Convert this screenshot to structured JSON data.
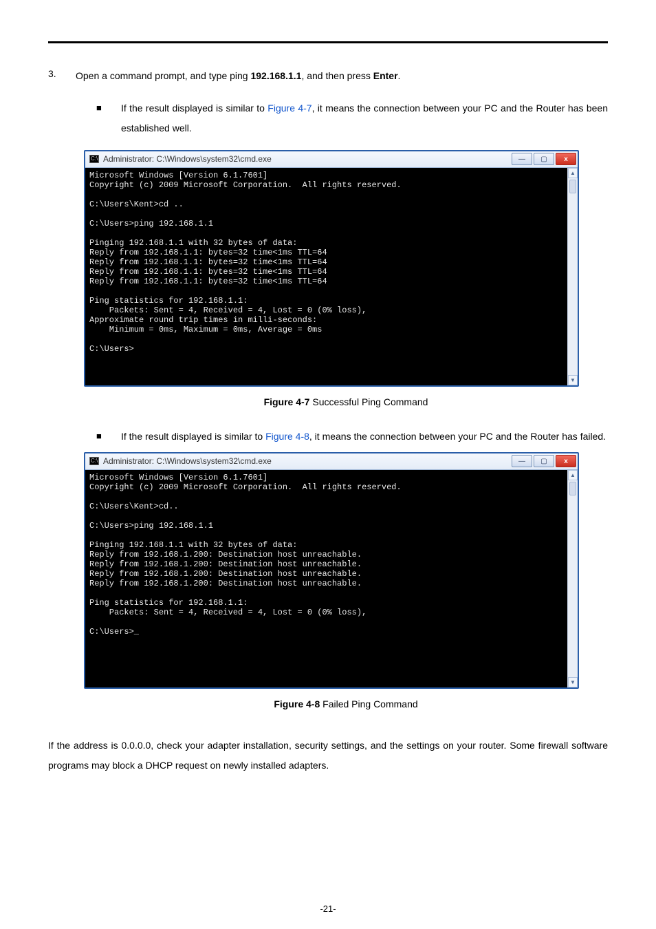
{
  "step": {
    "number": "3.",
    "pre": "Open a command prompt, and type ping ",
    "cmd": "192.168.1.1",
    "mid": ", and then press ",
    "enter": "Enter",
    "end": "."
  },
  "bullet_glyph": "■",
  "sub1": {
    "pre": "If the result displayed is similar to ",
    "link": "Figure 4-7",
    "post": ", it means the connection between your PC and the Router has been established well."
  },
  "sub2": {
    "pre": "If the result displayed is similar to ",
    "link": "Figure 4-8",
    "post": ", it means the connection between your PC and the Router has failed."
  },
  "cmd_title": "Administrator: C:\\Windows\\system32\\cmd.exe",
  "term1": "Microsoft Windows [Version 6.1.7601]\nCopyright (c) 2009 Microsoft Corporation.  All rights reserved.\n\nC:\\Users\\Kent>cd ..\n\nC:\\Users>ping 192.168.1.1\n\nPinging 192.168.1.1 with 32 bytes of data:\nReply from 192.168.1.1: bytes=32 time<1ms TTL=64\nReply from 192.168.1.1: bytes=32 time<1ms TTL=64\nReply from 192.168.1.1: bytes=32 time<1ms TTL=64\nReply from 192.168.1.1: bytes=32 time<1ms TTL=64\n\nPing statistics for 192.168.1.1:\n    Packets: Sent = 4, Received = 4, Lost = 0 (0% loss),\nApproximate round trip times in milli-seconds:\n    Minimum = 0ms, Maximum = 0ms, Average = 0ms\n\nC:\\Users>\n\n\n\n",
  "term2": "Microsoft Windows [Version 6.1.7601]\nCopyright (c) 2009 Microsoft Corporation.  All rights reserved.\n\nC:\\Users\\Kent>cd..\n\nC:\\Users>ping 192.168.1.1\n\nPinging 192.168.1.1 with 32 bytes of data:\nReply from 192.168.1.200: Destination host unreachable.\nReply from 192.168.1.200: Destination host unreachable.\nReply from 192.168.1.200: Destination host unreachable.\nReply from 192.168.1.200: Destination host unreachable.\n\nPing statistics for 192.168.1.1:\n    Packets: Sent = 4, Received = 4, Lost = 0 (0% loss),\n\nC:\\Users>_\n\n\n\n\n\n",
  "fig1": {
    "b": "Figure 4-7",
    "t": " Successful Ping Command"
  },
  "fig2": {
    "b": "Figure 4-8",
    "t": " Failed Ping Command"
  },
  "tail": "If the address is 0.0.0.0, check your adapter installation, security settings, and the settings on your router. Some firewall software programs may block a DHCP request on newly installed adapters.",
  "pagenum": "-21-",
  "winbtn": {
    "min": "—",
    "max": "▢",
    "close": "x"
  },
  "scroll": {
    "up": "▲",
    "down": "▼"
  },
  "cmdicon": "C:\\"
}
